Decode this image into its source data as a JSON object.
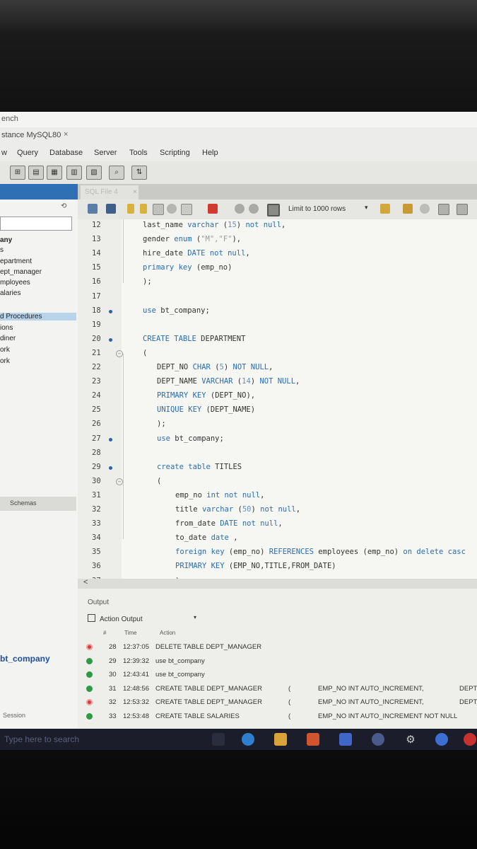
{
  "window": {
    "title": "ench",
    "instance_tab": "stance MySQL80",
    "tab_close": "×"
  },
  "menu": [
    "w",
    "Query",
    "Database",
    "Server",
    "Tools",
    "Scripting",
    "Help"
  ],
  "sidebar": {
    "refresh_glyph": "⟲",
    "items": [
      {
        "label": "any",
        "bold": true
      },
      {
        "label": "s",
        "bold": false
      },
      {
        "label": "epartment",
        "bold": false
      },
      {
        "label": "ept_manager",
        "bold": false
      },
      {
        "label": "mployees",
        "bold": false
      },
      {
        "label": "alaries",
        "bold": false
      },
      {
        "label": "",
        "bold": false
      },
      {
        "label": "d Procedures",
        "bold": false,
        "selected": true
      },
      {
        "label": "ions",
        "bold": false
      },
      {
        "label": "diner",
        "bold": false
      },
      {
        "label": "ork",
        "bold": false
      },
      {
        "label": "ork",
        "bold": false
      }
    ],
    "schemas_tab": "Schemas",
    "context_schema": "bt_company",
    "session_label": "Session"
  },
  "editor": {
    "tab_label": "SQL File 4",
    "tab_close": "×",
    "limit_label": "Limit to 1000 rows",
    "lines": [
      {
        "n": "12",
        "indent": 1,
        "segs": [
          [
            "last_name ",
            ""
          ],
          [
            "varchar",
            "kw"
          ],
          [
            " (",
            ""
          ],
          [
            "15",
            "num"
          ],
          [
            ") ",
            ""
          ],
          [
            "not null",
            "kw"
          ],
          [
            ",",
            ""
          ]
        ]
      },
      {
        "n": "13",
        "indent": 1,
        "segs": [
          [
            "gender ",
            ""
          ],
          [
            "enum",
            "kw"
          ],
          [
            " (",
            ""
          ],
          [
            "\"M\",\"F\"",
            "str"
          ],
          [
            "),",
            ""
          ]
        ]
      },
      {
        "n": "14",
        "indent": 1,
        "segs": [
          [
            "hire_date ",
            ""
          ],
          [
            "DATE not null",
            "kw"
          ],
          [
            ",",
            ""
          ]
        ]
      },
      {
        "n": "15",
        "indent": 1,
        "segs": [
          [
            "primary key",
            "kw"
          ],
          [
            " (emp_no)",
            ""
          ]
        ]
      },
      {
        "n": "16",
        "indent": 1,
        "segs": [
          [
            ");",
            ""
          ]
        ]
      },
      {
        "n": "17",
        "indent": 0,
        "segs": []
      },
      {
        "n": "18",
        "indent": 1,
        "dot": true,
        "segs": [
          [
            "use",
            "kw"
          ],
          [
            " bt_company;",
            ""
          ]
        ]
      },
      {
        "n": "19",
        "indent": 0,
        "segs": []
      },
      {
        "n": "20",
        "indent": 1,
        "dot": true,
        "segs": [
          [
            "CREATE TABLE",
            "kw"
          ],
          [
            " DEPARTMENT",
            ""
          ]
        ]
      },
      {
        "n": "21",
        "indent": 1,
        "fold": true,
        "segs": [
          [
            "(",
            ""
          ]
        ]
      },
      {
        "n": "22",
        "indent": 2,
        "segs": [
          [
            "DEPT_NO ",
            ""
          ],
          [
            "CHAR",
            "kw"
          ],
          [
            " (",
            ""
          ],
          [
            "5",
            "num"
          ],
          [
            ") ",
            ""
          ],
          [
            "NOT NULL",
            "kw"
          ],
          [
            ",",
            ""
          ]
        ]
      },
      {
        "n": "23",
        "indent": 2,
        "segs": [
          [
            "DEPT_NAME ",
            ""
          ],
          [
            "VARCHAR",
            "kw"
          ],
          [
            " (",
            ""
          ],
          [
            "14",
            "num"
          ],
          [
            ") ",
            ""
          ],
          [
            "NOT NULL",
            "kw"
          ],
          [
            ",",
            ""
          ]
        ]
      },
      {
        "n": "24",
        "indent": 2,
        "segs": [
          [
            "PRIMARY KEY",
            "kw"
          ],
          [
            " (DEPT_NO),",
            ""
          ]
        ]
      },
      {
        "n": "25",
        "indent": 2,
        "segs": [
          [
            "UNIQUE KEY",
            "kw"
          ],
          [
            " (DEPT_NAME)",
            ""
          ]
        ]
      },
      {
        "n": "26",
        "indent": 2,
        "segs": [
          [
            ");",
            ""
          ]
        ]
      },
      {
        "n": "27",
        "indent": 2,
        "dot": true,
        "segs": [
          [
            "use",
            "kw"
          ],
          [
            " bt_company;",
            ""
          ]
        ]
      },
      {
        "n": "28",
        "indent": 0,
        "segs": []
      },
      {
        "n": "29",
        "indent": 2,
        "dot": true,
        "segs": [
          [
            "create table",
            "kw"
          ],
          [
            " TITLES",
            ""
          ]
        ]
      },
      {
        "n": "30",
        "indent": 2,
        "fold": true,
        "segs": [
          [
            "(",
            ""
          ]
        ]
      },
      {
        "n": "31",
        "indent": 3,
        "segs": [
          [
            "emp_no ",
            ""
          ],
          [
            "int not null",
            "kw"
          ],
          [
            ",",
            ""
          ]
        ]
      },
      {
        "n": "32",
        "indent": 3,
        "segs": [
          [
            "title ",
            ""
          ],
          [
            "varchar",
            "kw"
          ],
          [
            " (",
            ""
          ],
          [
            "50",
            "num"
          ],
          [
            ") ",
            ""
          ],
          [
            "not null",
            "kw"
          ],
          [
            ",",
            ""
          ]
        ]
      },
      {
        "n": "33",
        "indent": 3,
        "segs": [
          [
            "from_date ",
            ""
          ],
          [
            "DATE not null",
            "kw"
          ],
          [
            ",",
            ""
          ]
        ]
      },
      {
        "n": "34",
        "indent": 3,
        "segs": [
          [
            "to_date ",
            ""
          ],
          [
            "date",
            "kw"
          ],
          [
            " ,",
            ""
          ]
        ]
      },
      {
        "n": "35",
        "indent": 3,
        "segs": [
          [
            "foreign key",
            "kw"
          ],
          [
            " (emp_no) ",
            ""
          ],
          [
            "REFERENCES",
            "kw"
          ],
          [
            " employees (emp_no) ",
            ""
          ],
          [
            "on delete casc",
            "kw"
          ]
        ]
      },
      {
        "n": "36",
        "indent": 3,
        "segs": [
          [
            "PRIMARY KEY",
            "kw"
          ],
          [
            " (EMP_NO,TITLE,FROM_DATE)",
            ""
          ]
        ]
      },
      {
        "n": "37",
        "indent": 3,
        "segs": [
          [
            ")",
            ""
          ]
        ]
      }
    ],
    "scroll_left": "<"
  },
  "output": {
    "title": "Output",
    "mode": "Action Output",
    "columns": [
      "#",
      "Time",
      "Action"
    ],
    "rows": [
      {
        "status": "err",
        "num": "28",
        "time": "12:37:05",
        "action": "DELETE TABLE DEPT_MANAGER",
        "c2": "",
        "c3": "",
        "c4": ""
      },
      {
        "status": "ok",
        "num": "29",
        "time": "12:39:32",
        "action": "use bt_company",
        "c2": "",
        "c3": "",
        "c4": ""
      },
      {
        "status": "ok",
        "num": "30",
        "time": "12:43:41",
        "action": "use bt_company",
        "c2": "",
        "c3": "",
        "c4": ""
      },
      {
        "status": "ok",
        "num": "31",
        "time": "12:48:56",
        "action": "CREATE TABLE DEPT_MANAGER",
        "c2": "(",
        "c3": "EMP_NO INT AUTO_INCREMENT,",
        "c4": "DEPT"
      },
      {
        "status": "err",
        "num": "32",
        "time": "12:53:32",
        "action": "CREATE TABLE DEPT_MANAGER",
        "c2": "(",
        "c3": "EMP_NO INT AUTO_INCREMENT,",
        "c4": "DEPT"
      },
      {
        "status": "ok",
        "num": "33",
        "time": "12:53:48",
        "action": "CREATE TABLE SALARIES",
        "c2": "(",
        "c3": "EMP_NO INT AUTO_INCREMENT NOT NULL",
        "c4": ""
      }
    ]
  },
  "taskbar": {
    "search_placeholder": "Type here to search"
  },
  "colors": {
    "keyword": "#2a6db0",
    "string": "#9a9a9a",
    "status_ok": "#2e9a45",
    "status_error": "#d73a3a",
    "selection": "#b9d3ea"
  }
}
